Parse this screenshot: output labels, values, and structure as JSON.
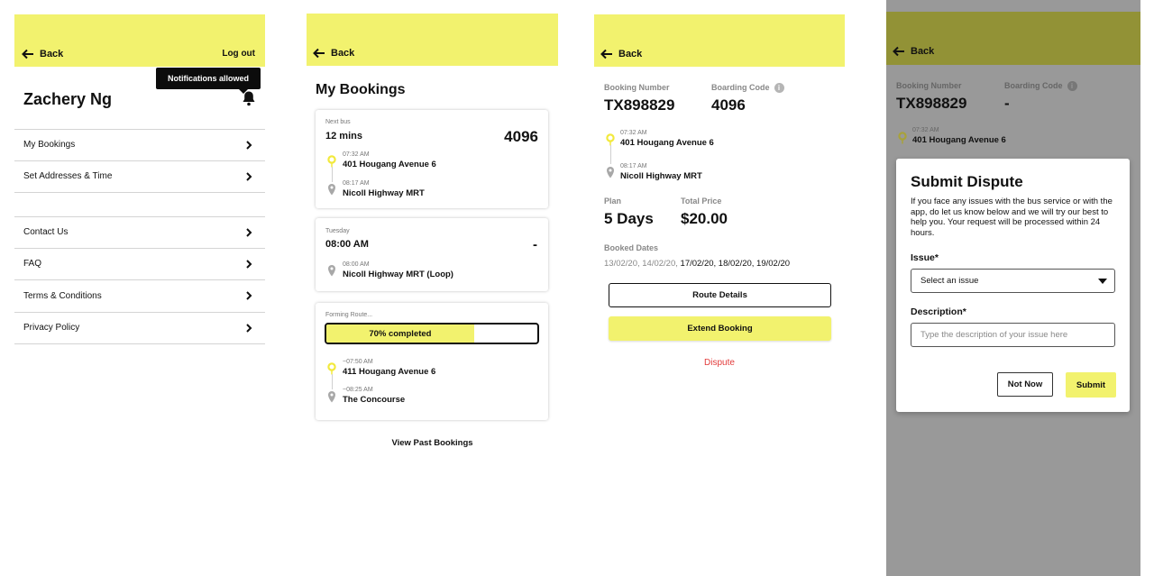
{
  "colors": {
    "accent": "#f2f26e",
    "dispute": "#e23b3b",
    "overlay_header": "#929236",
    "overlay": "#999999"
  },
  "profile": {
    "back_label": "Back",
    "logout_label": "Log out",
    "tooltip": "Notifications allowed",
    "name": "Zachery Ng",
    "menu_primary": [
      {
        "label": "My Bookings"
      },
      {
        "label": "Set Addresses & Time"
      }
    ],
    "menu_secondary": [
      {
        "label": "Contact Us"
      },
      {
        "label": "FAQ"
      },
      {
        "label": "Terms & Conditions"
      },
      {
        "label": "Privacy Policy"
      }
    ]
  },
  "bookings": {
    "back_label": "Back",
    "title": "My Bookings",
    "card1": {
      "eyebrow": "Next bus",
      "eta": "12 mins",
      "bus_number": "4096",
      "stop1_time": "07:32 AM",
      "stop1_name": "401 Hougang Avenue 6",
      "stop2_time": "08:17 AM",
      "stop2_name": "Nicoll Highway MRT"
    },
    "card2": {
      "eyebrow": "Tuesday",
      "time": "08:00 AM",
      "dash": "-",
      "stop_time": "08:00 AM",
      "stop_name": "Nicoll Highway MRT (Loop)"
    },
    "card3": {
      "eyebrow": "Forming Route...",
      "progress_label": "70% completed",
      "progress_fraction": 0.7,
      "stop1_time": "~07:50 AM",
      "stop1_name": "411 Hougang Avenue 6",
      "stop2_time": "~08:25 AM",
      "stop2_name": "The Concourse"
    },
    "view_past": "View Past Bookings"
  },
  "detail": {
    "back_label": "Back",
    "booking_number_label": "Booking Number",
    "booking_number": "TX898829",
    "boarding_code_label": "Boarding Code",
    "boarding_code": "4096",
    "info_icon": "i",
    "stop1_time": "07:32 AM",
    "stop1_name": "401 Hougang Avenue 6",
    "stop2_time": "08:17 AM",
    "stop2_name": "Nicoll Highway MRT",
    "plan_label": "Plan",
    "plan": "5 Days",
    "total_label": "Total Price",
    "total": "$20.00",
    "booked_dates_label": "Booked Dates",
    "past_dates": "13/02/20, 14/02/20, ",
    "upcoming_dates": "17/02/20, 18/02/20, 19/02/20",
    "route_details": "Route Details",
    "extend_booking": "Extend Booking",
    "dispute": "Dispute"
  },
  "dispute_screen": {
    "back_label": "Back",
    "booking_number_label": "Booking Number",
    "booking_number": "TX898829",
    "boarding_code_label": "Boarding Code",
    "boarding_code": "-",
    "info_icon": "i",
    "stop1_time": "07:32 AM",
    "stop1_name": "401 Hougang Avenue 6",
    "modal": {
      "title": "Submit Dispute",
      "description": "If you face any issues with the bus service or with the app, do let us know below and we will try our best to help you. Your request will be processed within 24 hours.",
      "issue_label": "Issue*",
      "issue_selected": "Select an issue",
      "description_label": "Description*",
      "description_placeholder": "Type the description of your issue here",
      "not_now": "Not Now",
      "submit": "Submit"
    }
  }
}
